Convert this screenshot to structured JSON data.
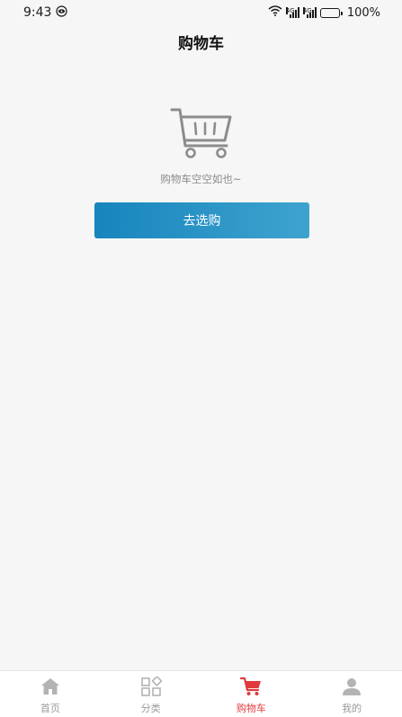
{
  "status_bar": {
    "time": "9:43",
    "network_1": "4G",
    "network_2": "4G",
    "battery": "100%",
    "battery_level": 1.0
  },
  "header": {
    "title": "购物车"
  },
  "empty_state": {
    "icon": "shopping-cart-icon",
    "message": "购物车空空如也~",
    "button_label": "去选购",
    "button_color_start": "#1785bd",
    "button_color_end": "#3fa3cf"
  },
  "tab_bar": {
    "active_color": "#e0393e",
    "inactive_color": "#9b9b9b",
    "items": [
      {
        "label": "首页",
        "icon": "home-icon",
        "active": false
      },
      {
        "label": "分类",
        "icon": "category-grid-icon",
        "active": false
      },
      {
        "label": "购物车",
        "icon": "cart-icon",
        "active": true
      },
      {
        "label": "我的",
        "icon": "user-icon",
        "active": false
      }
    ]
  }
}
